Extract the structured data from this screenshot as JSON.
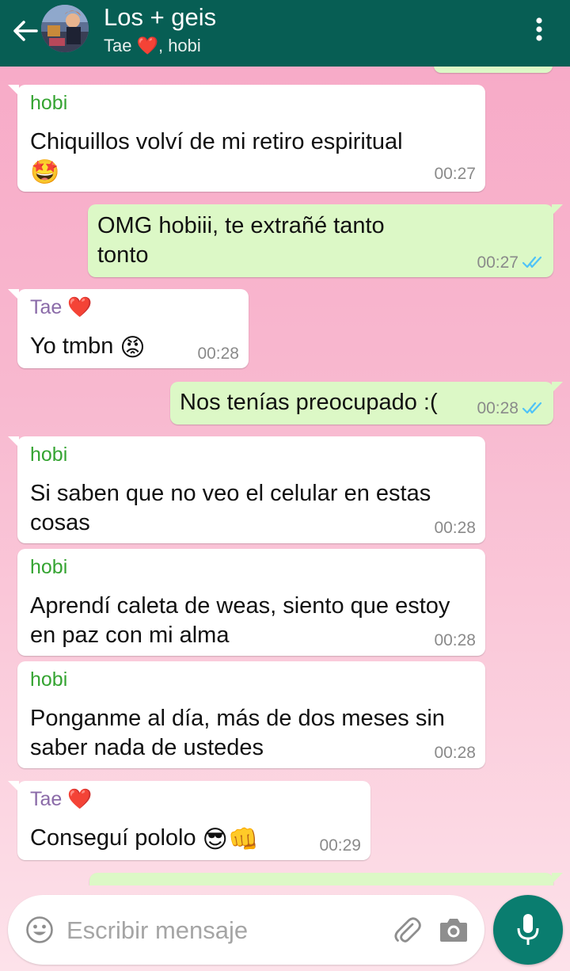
{
  "header": {
    "title": "Los + geis",
    "subtitle": "Tae ❤️, hobi"
  },
  "messages": [
    {
      "sender": "hobi",
      "text": "Chiquillos volví de mi retiro espiritual",
      "emoji": "🤩",
      "time": "00:27"
    },
    {
      "text_line1": "OMG hobiii, te extrañé tanto",
      "text_line2": "tonto",
      "time": "00:27"
    },
    {
      "sender": "Tae ❤️",
      "text": "Yo tmbn",
      "emoji": "😡",
      "time": "00:28"
    },
    {
      "text": "Nos tenías preocupado :(",
      "time": "00:28"
    },
    {
      "sender": "hobi",
      "text_line1": "Si saben que no veo el celular en estas",
      "text_line2": "cosas",
      "time": "00:28"
    },
    {
      "sender": "hobi",
      "text_line1": "Aprendí caleta de weas, siento que estoy",
      "text_line2": "en paz con mi alma",
      "time": "00:28"
    },
    {
      "sender": "hobi",
      "text_line1": "Ponganme al día, más de dos meses sin",
      "text_line2": "saber nada de ustedes",
      "time": "00:28"
    },
    {
      "sender": "Tae ❤️",
      "text": "Conseguí pololo",
      "emoji": "😎👊",
      "time": "00:29"
    }
  ],
  "composer": {
    "placeholder": "Escribir mensaje"
  },
  "colors": {
    "header": "#075e54",
    "outgoing": "#dcf8c6",
    "incoming": "#ffffff",
    "hobi_name": "#35a432",
    "tae_name": "#8a6aa8",
    "read_ticks": "#4fc3f7",
    "mic_button": "#0a7d6f"
  },
  "icons": [
    "back-arrow-icon",
    "menu-dots-icon",
    "smiley-icon",
    "paperclip-icon",
    "camera-icon",
    "mic-icon",
    "double-check-icon"
  ]
}
